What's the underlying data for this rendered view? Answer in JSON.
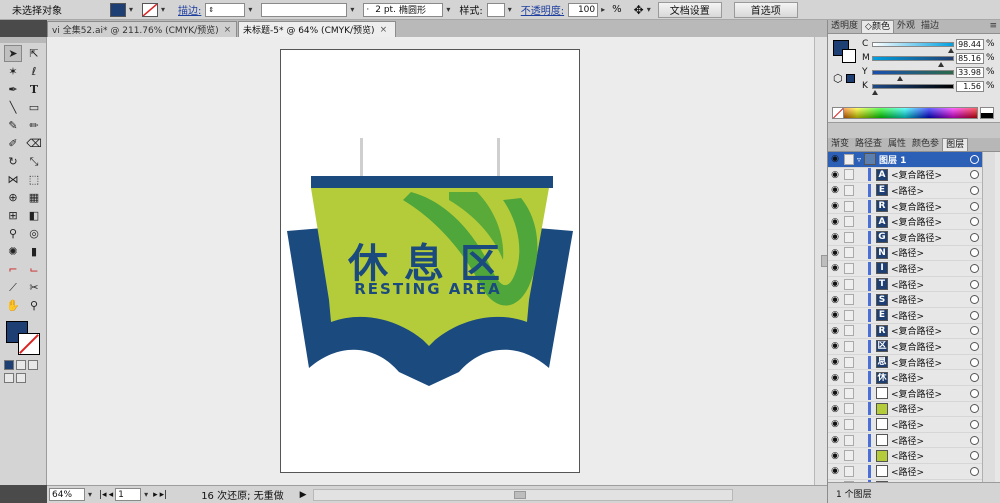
{
  "control_bar": {
    "selection_label": "未选择对象",
    "stroke_label": "描边:",
    "stroke_weight": "",
    "brush_weight": "2 pt.",
    "brush_shape": "椭圆形",
    "style_label": "样式:",
    "opacity_label": "不透明度:",
    "opacity_value": "100",
    "opacity_unit": "%",
    "doc_settings_button": "文档设置",
    "preferences_button": "首选项"
  },
  "tabs": [
    {
      "label": "vi 全集52.ai* @ 211.76% (CMYK/预览)",
      "close": "×"
    },
    {
      "label": "未标题-5* @ 64% (CMYK/预览)",
      "close": "×"
    }
  ],
  "artwork": {
    "title_cn": "休息区",
    "title_en": "RESTING AREA",
    "colors": {
      "navy": "#1a4a7e",
      "lime": "#b5cc3a",
      "green": "#4aa33a"
    }
  },
  "status_bar": {
    "zoom": "64%",
    "page": "1",
    "undo_info": "16 次还原; 无重做"
  },
  "color_panel": {
    "tabs": [
      "透明度",
      "颜色",
      "外观",
      "描边"
    ],
    "active_tab": "颜色",
    "channels": [
      {
        "letter": "C",
        "value": "98.44",
        "unit": "%"
      },
      {
        "letter": "M",
        "value": "85.16",
        "unit": "%"
      },
      {
        "letter": "Y",
        "value": "33.98",
        "unit": "%"
      },
      {
        "letter": "K",
        "value": "1.56",
        "unit": "%"
      }
    ]
  },
  "layers_panel": {
    "tabs": [
      "渐变",
      "路径查",
      "属性",
      "颜色参",
      "图层"
    ],
    "active_tab": "图层",
    "layer_name": "图层 1",
    "items": [
      {
        "thumb": "A",
        "name": "<复合路径>"
      },
      {
        "thumb": "E",
        "name": "<路径>"
      },
      {
        "thumb": "R",
        "name": "<复合路径>"
      },
      {
        "thumb": "A",
        "name": "<复合路径>"
      },
      {
        "thumb": "G",
        "name": "<复合路径>"
      },
      {
        "thumb": "N",
        "name": "<路径>"
      },
      {
        "thumb": "I",
        "name": "<路径>"
      },
      {
        "thumb": "T",
        "name": "<路径>"
      },
      {
        "thumb": "S",
        "name": "<路径>"
      },
      {
        "thumb": "E",
        "name": "<路径>"
      },
      {
        "thumb": "R",
        "name": "<复合路径>"
      },
      {
        "thumb": "区",
        "name": "<复合路径>"
      },
      {
        "thumb": "息",
        "name": "<复合路径>"
      },
      {
        "thumb": "休",
        "name": "<路径>"
      },
      {
        "thumb": "",
        "name": "<复合路径>"
      },
      {
        "thumb": "",
        "name": "<路径>"
      },
      {
        "thumb": "",
        "name": "<路径>"
      },
      {
        "thumb": "",
        "name": "<路径>"
      },
      {
        "thumb": "",
        "name": "<路径>"
      },
      {
        "thumb": "",
        "name": "<路径>"
      },
      {
        "thumb": "",
        "name": "<路径>"
      }
    ],
    "footer": "1 个图层"
  }
}
